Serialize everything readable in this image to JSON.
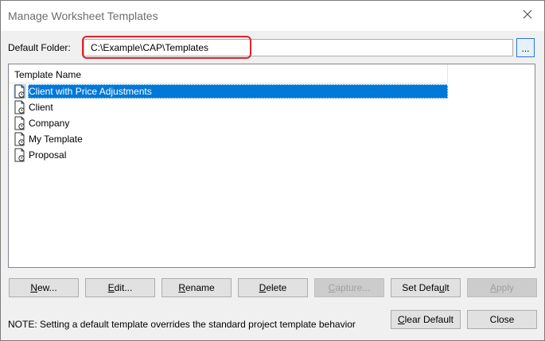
{
  "window": {
    "title": "Manage Worksheet Templates"
  },
  "folder": {
    "label": "Default Folder:",
    "value": "C:\\Example\\CAP\\Templates",
    "browse_label": "..."
  },
  "list": {
    "column_header": "Template Name",
    "items": [
      {
        "label": "Client with Price Adjustments",
        "selected": true
      },
      {
        "label": "Client",
        "selected": false
      },
      {
        "label": "Company",
        "selected": false
      },
      {
        "label": "My Template",
        "selected": false
      },
      {
        "label": "Proposal",
        "selected": false
      }
    ]
  },
  "buttons": {
    "new": {
      "m": "N",
      "rest": "ew...",
      "enabled": true
    },
    "edit": {
      "m": "E",
      "rest": "dit...",
      "enabled": true
    },
    "rename": {
      "m": "R",
      "rest": "ename",
      "enabled": true
    },
    "delete": {
      "m": "D",
      "rest": "elete",
      "enabled": true
    },
    "capture": {
      "m": "C",
      "rest": "apture...",
      "enabled": false
    },
    "set_default": {
      "pre": "Set Defa",
      "m": "u",
      "rest": "lt",
      "enabled": true
    },
    "apply": {
      "m": "A",
      "rest": "pply",
      "enabled": false
    },
    "clear_default": {
      "m": "C",
      "rest": "lear Default",
      "enabled": true
    },
    "close": {
      "label": "Close",
      "enabled": true
    }
  },
  "note": "NOTE: Setting a default template overrides the standard project template behavior",
  "colors": {
    "selection": "#0078d7",
    "highlight_ring": "#e0242b",
    "disabled_text": "#a0a0a0"
  }
}
